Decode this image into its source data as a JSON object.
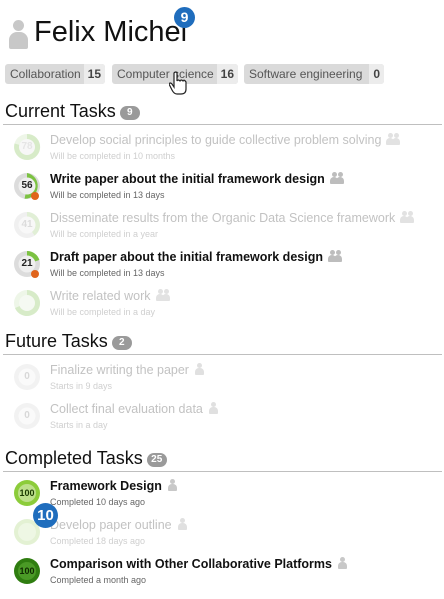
{
  "profile": {
    "name": "Felix Michel",
    "badge": "9"
  },
  "tags": [
    {
      "label": "Collaboration",
      "count": "15"
    },
    {
      "label": "Computer science",
      "count": "16"
    },
    {
      "label": "Software engineering",
      "count": "0"
    }
  ],
  "sections": {
    "current": {
      "title": "Current Tasks",
      "count": "9"
    },
    "future": {
      "title": "Future Tasks",
      "count": "2"
    },
    "completed": {
      "title": "Completed Tasks",
      "count": "25"
    }
  },
  "current_tasks": [
    {
      "progress": "78",
      "title": "Develop social principles to guide collective problem solving",
      "sub": "Will be completed in 10 months"
    },
    {
      "progress": "56",
      "title": "Write paper about the initial framework design",
      "sub": "Will be completed in 13 days"
    },
    {
      "progress": "41",
      "title": "Disseminate results from the Organic Data Science framework",
      "sub": "Will be completed in a year"
    },
    {
      "progress": "21",
      "title": "Draft paper about the initial framework design",
      "sub": "Will be completed in 13 days"
    },
    {
      "progress": "",
      "title": "Write related work",
      "sub": "Will be completed in a day"
    }
  ],
  "future_tasks": [
    {
      "progress": "0",
      "title": "Finalize writing the paper",
      "sub": "Starts in 9 days"
    },
    {
      "progress": "0",
      "title": "Collect final evaluation data",
      "sub": "Starts in a day"
    }
  ],
  "completed_tasks": [
    {
      "progress": "100",
      "title": "Framework Design",
      "sub": "Completed 10 days ago"
    },
    {
      "progress": "",
      "title": "Develop paper outline",
      "sub": "Completed 18 days ago"
    },
    {
      "progress": "100",
      "title": "Comparison with Other Collaborative Platforms",
      "sub": "Completed a month ago"
    }
  ],
  "overlay_badge": "10",
  "colors": {
    "progress_green": "#7cc242",
    "dark_green": "#3c8a1e",
    "late_orange": "#e0641c",
    "badge_blue": "#1f6dbd"
  }
}
